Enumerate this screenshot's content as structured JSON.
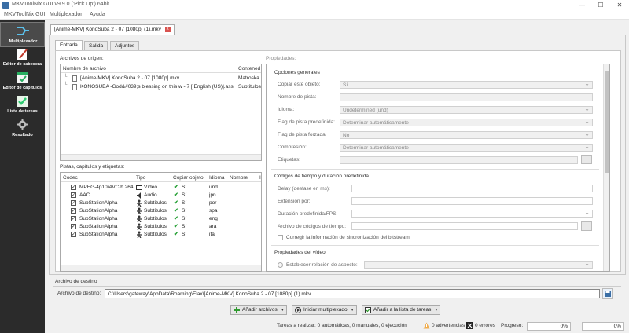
{
  "window": {
    "title": "MKVToolNix GUI v9.9.0 ('Pick Up') 64bit"
  },
  "menu": {
    "items": [
      "MKVToolNix GUI",
      "Multiplexador",
      "Ayuda"
    ]
  },
  "sidebar": {
    "items": [
      {
        "label": "Multiplexador",
        "icon": "multiplexer-icon",
        "active": true
      },
      {
        "label": "Editor de cabecera",
        "icon": "header-editor-icon"
      },
      {
        "label": "Editor de capítulos",
        "icon": "chapter-editor-icon"
      },
      {
        "label": "Lista de tareas",
        "icon": "job-queue-icon"
      },
      {
        "label": "Resultado",
        "icon": "job-output-icon"
      }
    ]
  },
  "document_tab": {
    "label": "[Anime-MKV] KonoSuba 2 - 07 [1080p] (1).mkv",
    "close": "x"
  },
  "subtabs": [
    "Entrada",
    "Salida",
    "Adjuntos"
  ],
  "source_files": {
    "group_label": "Archivos de origen:",
    "columns": [
      "Nombre de archivo",
      "Contened"
    ],
    "rows": [
      {
        "name": "[Anime-MKV] KonoSuba 2 - 07 [1080p].mkv",
        "container": "Matroska"
      },
      {
        "name": "KONOSUBA -God&#039;s blessing on this w - 7 [ English (US)].ass",
        "container": "Subtítulos"
      }
    ]
  },
  "tracks": {
    "group_label": "Pistas, capítulos y etiquetas:",
    "columns": [
      "Codec",
      "Tipo",
      "Copiar objeto",
      "Idioma",
      "Nombre",
      "I"
    ],
    "rows": [
      {
        "codec": "MPEG-4p10/AVC/h.264",
        "type": "Vídeo",
        "copy": "Sí",
        "lang": "und"
      },
      {
        "codec": "AAC",
        "type": "Audio",
        "copy": "Sí",
        "lang": "jpn"
      },
      {
        "codec": "SubStationAlpha",
        "type": "Subtítulos",
        "copy": "Sí",
        "lang": "por"
      },
      {
        "codec": "SubStationAlpha",
        "type": "Subtítulos",
        "copy": "Sí",
        "lang": "spa"
      },
      {
        "codec": "SubStationAlpha",
        "type": "Subtítulos",
        "copy": "Sí",
        "lang": "eng"
      },
      {
        "codec": "SubStationAlpha",
        "type": "Subtítulos",
        "copy": "Sí",
        "lang": "ara"
      },
      {
        "codec": "SubStationAlpha",
        "type": "Subtítulos",
        "copy": "Sí",
        "lang": "ita"
      }
    ]
  },
  "properties": {
    "group_label": "Propiedades:",
    "general": {
      "title": "Opciones generales",
      "fields": [
        {
          "label": "Copiar este objeto:",
          "value": "Sí"
        },
        {
          "label": "Nombre de pista:",
          "value": ""
        },
        {
          "label": "Idioma:",
          "value": "Undetermined (und)"
        },
        {
          "label": "Flag de pista predefinida:",
          "value": "Determinar automáticamente"
        },
        {
          "label": "Flag de pista forzada:",
          "value": "No"
        },
        {
          "label": "Compresión:",
          "value": "Determinar automáticamente"
        },
        {
          "label": "Etiquetas:",
          "value": ""
        }
      ]
    },
    "timing": {
      "title": "Códigos de tiempo y duración predefinida",
      "fields": [
        {
          "label": "Delay (desfase en ms):",
          "value": ""
        },
        {
          "label": "Extensión por:",
          "value": ""
        },
        {
          "label": "Duración predefinida/FPS:",
          "value": ""
        },
        {
          "label": "Archivo de códigos de tiempo:",
          "value": ""
        }
      ],
      "checkbox": "Corregir la información de sincronización del bitstream"
    },
    "video": {
      "title": "Propiedades del vídeo",
      "radio": "Establecer relación de aspecto:"
    }
  },
  "destination": {
    "group_label": "Archivo de destino",
    "label": "Archivo de destino:",
    "value": "C:\\Users\\gateway\\AppData\\Roaming\\Elax\\[Anime-MKV] KonoSuba 2 - 07 [1080p] (1).mkv"
  },
  "actions": {
    "add_files": "Añadir archivos",
    "start_mux": "Iniciar multiplexado",
    "add_queue": "Añadir a la lista de tareas"
  },
  "status": {
    "tasks": "Tareas a realizar: 0 automáticas, 0 manuales, 0 ejecución",
    "warnings": "0 advertencias",
    "errors": "0 errores",
    "progress_label": "Progreso:",
    "progress1": "0%",
    "progress2": "0%"
  },
  "colors": {
    "sidebar_bg": "#2b2b2b",
    "check_green": "#1a9a2a",
    "close_red": "#d9534f"
  }
}
